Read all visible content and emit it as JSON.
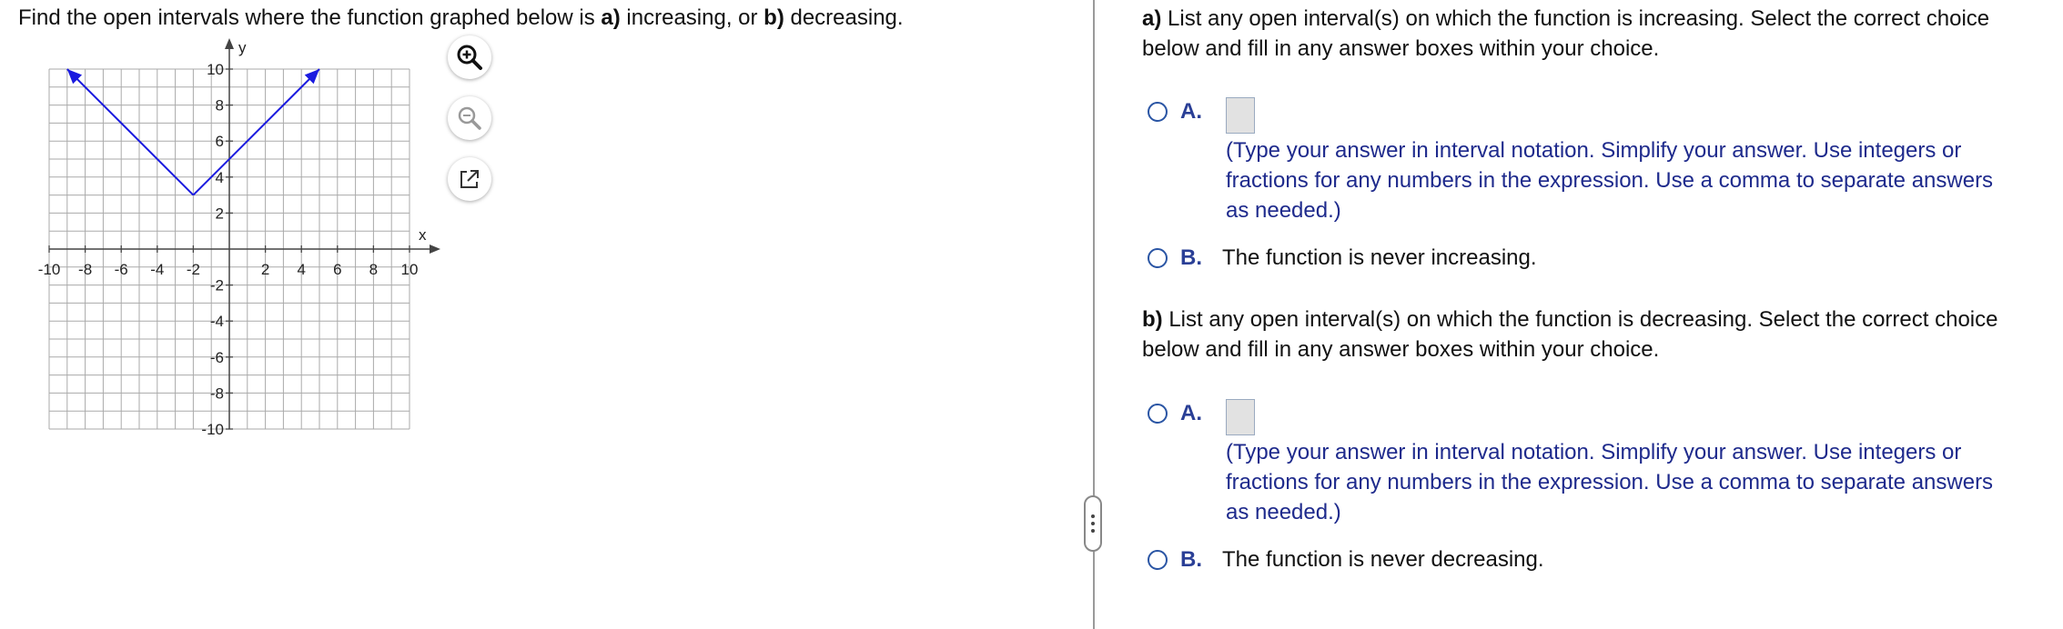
{
  "question": {
    "prefix": "Find the open intervals where the function graphed below is ",
    "part_a_marker": "a)",
    "part_a_word": " increasing, or ",
    "part_b_marker": "b)",
    "part_b_word": " decreasing."
  },
  "graph": {
    "x_axis_label": "x",
    "y_axis_label": "y",
    "x_tick_labels": [
      "-10",
      "-8",
      "-6",
      "-4",
      "-2",
      "2",
      "4",
      "6",
      "8",
      "10"
    ],
    "y_tick_labels": [
      "10",
      "8",
      "6",
      "4",
      "2",
      "-2",
      "-4",
      "-6",
      "-8",
      "-10"
    ],
    "x_range": [
      -10,
      10
    ],
    "y_range": [
      -10,
      10
    ],
    "grid": true,
    "function_vertex": [
      -2,
      3
    ],
    "left_arrow_end": [
      -9,
      10
    ],
    "right_arrow_end": [
      5,
      10
    ],
    "line_color": "#1a1adf"
  },
  "tools": {
    "zoom_in_icon": "zoom-in-icon",
    "zoom_out_icon": "zoom-out-icon",
    "popout_icon": "popout-icon"
  },
  "part_a": {
    "marker": "a)",
    "prompt_line1": " List any open interval(s) on which the function is increasing. Select the correct choice",
    "prompt_line2": "below and fill in any answer boxes within your choice.",
    "option_a_letter": "A.",
    "option_a_hint": "(Type your answer in interval notation. Simplify your answer. Use integers or\nfractions for any numbers in the expression. Use a comma to separate answers\nas needed.)",
    "option_b_letter": "B.",
    "option_b_text": "The function is never increasing."
  },
  "part_b": {
    "marker": "b)",
    "prompt_line1": " List any open interval(s) on which the function is decreasing. Select the correct choice",
    "prompt_line2": "below and fill in any answer boxes within your choice.",
    "option_a_letter": "A.",
    "option_a_hint": "(Type your answer in interval notation. Simplify your answer. Use integers or\nfractions for any numbers in the expression. Use a comma to separate answers\nas needed.)",
    "option_b_letter": "B.",
    "option_b_text": "The function is never decreasing."
  }
}
